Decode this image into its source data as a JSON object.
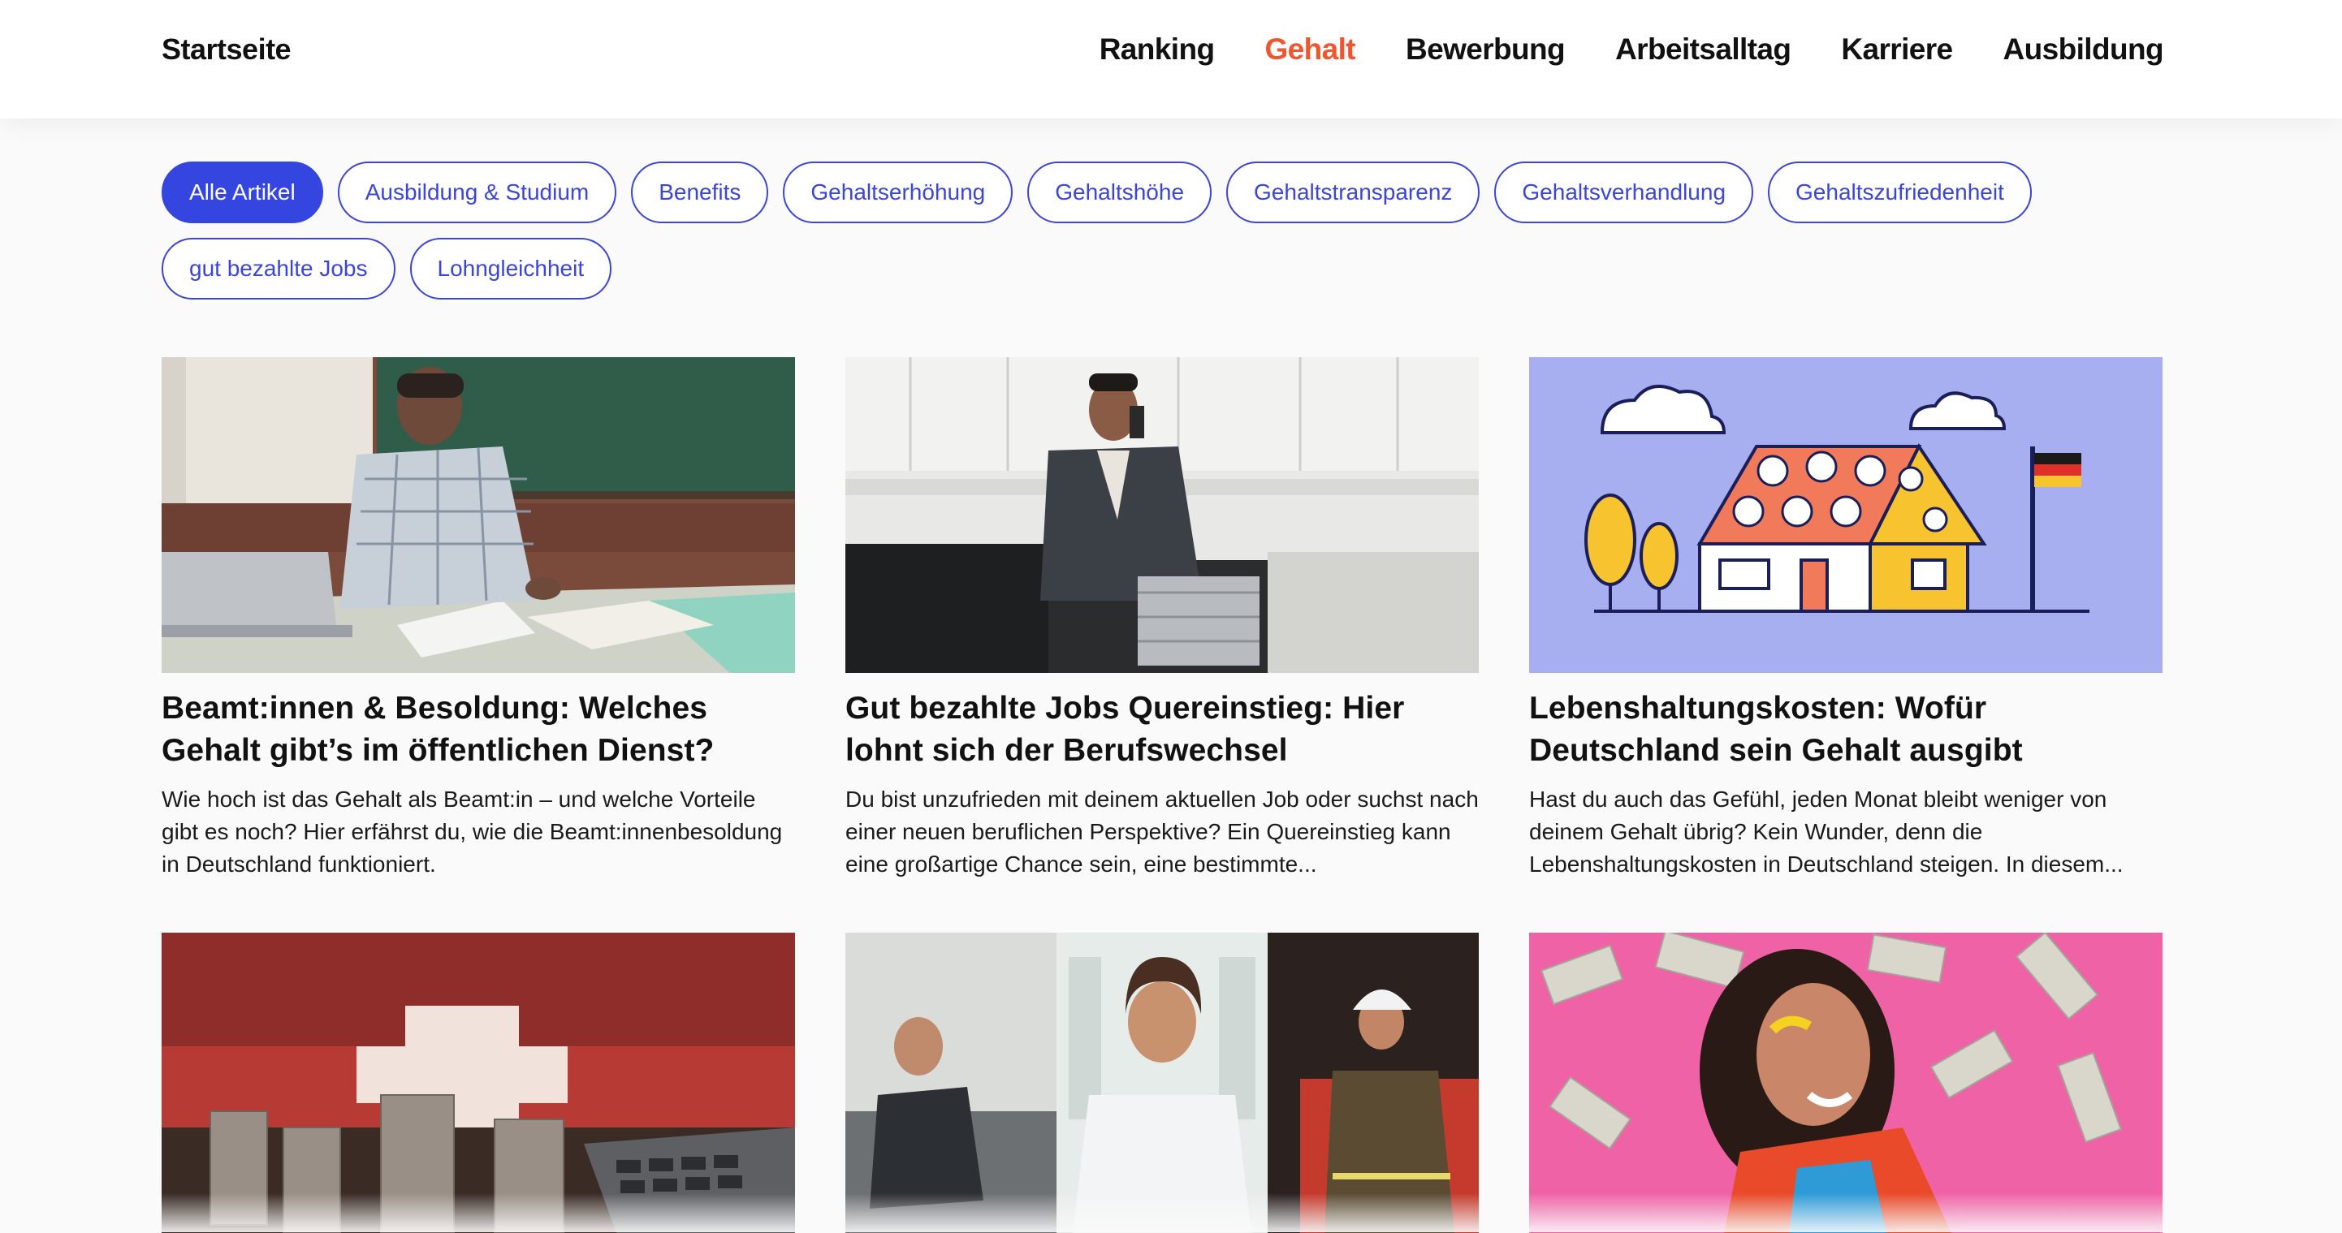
{
  "header": {
    "brand": "Startseite",
    "nav": [
      "Ranking",
      "Gehalt",
      "Bewerbung",
      "Arbeitsalltag",
      "Karriere",
      "Ausbildung"
    ],
    "active_nav": "Gehalt"
  },
  "filters": [
    "Alle Artikel",
    "Ausbildung & Studium",
    "Benefits",
    "Gehaltserhöhung",
    "Gehaltshöhe",
    "Gehaltstransparenz",
    "Gehaltsverhandlung",
    "Gehaltszufriedenheit",
    "gut bezahlte Jobs",
    "Lohngleichheit"
  ],
  "active_filter": "Alle Artikel",
  "articles": [
    {
      "title": "Beamt:innen & Besoldung: Welches Gehalt gibt’s im öffentlichen Dienst?",
      "desc": "Wie hoch ist das Gehalt als Beamt:in – und welche Vorteile gibt es noch? Hier erfährst du, wie die Beamt:innenbesoldung in Deutschland funktioniert."
    },
    {
      "title": "Gut bezahlte Jobs Quereinstieg: Hier lohnt sich der Berufswechsel",
      "desc": "Du bist unzufrieden mit deinem aktuellen Job oder suchst nach einer neuen beruflichen Perspektive? Ein Quereinstieg kann eine großartige Chance sein, eine bestimmte..."
    },
    {
      "title": "Lebenshaltungskosten: Wofür Deutschland sein Gehalt ausgibt",
      "desc": "Hast du auch das Gefühl, jeden Monat bleibt weniger von deinem Gehalt übrig? Kein Wunder, denn die Lebenshaltungskosten in Deutschland steigen. In diesem..."
    }
  ],
  "colors": {
    "accent": "#3445e0",
    "active_nav": "#f0552d"
  }
}
